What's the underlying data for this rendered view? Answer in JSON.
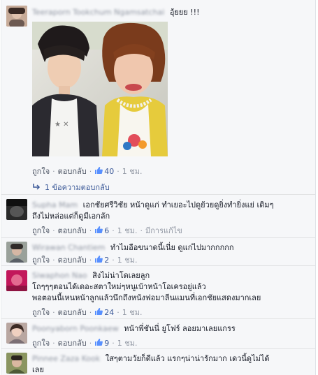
{
  "comments": [
    {
      "name": "Teeraporn Tookchum Ngamsatchai",
      "text": "อุ้ยยย !!!",
      "like_label": "ถูกใจ",
      "reply_label": "ตอบกลับ",
      "likes": "40",
      "time": "1 ชม.",
      "replies_link": "1 ข้อความตอบกลับ"
    },
    {
      "name": "Supha Mam",
      "text_lines": [
        "เอกชัยศรีวิชัย หน้าดูแก่ ทำเยอะไปดูย้วยดูยิ่งทำยิ่งแย่ เดิมๆ",
        "ถึงไม่หล่อแต่ก็ดูมีเอกลัก"
      ],
      "like_label": "ถูกใจ",
      "reply_label": "ตอบกลับ",
      "likes": "6",
      "time": "1 ชม.",
      "edited": "มีการแก้ไข"
    },
    {
      "name": "Wirawan Chantiem",
      "text": "ทำไมอือขนาดนี้เนี่ย ดูแก่ไปมากกกกก",
      "like_label": "ถูกใจ",
      "reply_label": "ตอบกลับ",
      "likes": "2",
      "time": "1 ชม."
    },
    {
      "name": "Siwaphon Nao",
      "text_lines": [
        "สิงไม่น่าโดเลยลูก",
        "โถๆๆๆตอนได้เดอะสตาใหม่ๆหนูเบ้าหน้าโอเครอยู่แล้ว",
        "พอตอนนี้เหนหน้าลูกแล้วนึกถึงหนังฟอมาลีนแมนที่เอกชัยแสดงมากเลย"
      ],
      "like_label": "ถูกใจ",
      "reply_label": "ตอบกลับ",
      "likes": "24",
      "time": "1 ชม."
    },
    {
      "name": "Poonyaborn Poonkaew",
      "text": "หน้าพี่ชันนี่ ยูโฟร์ ลอยมาเลยแกรร",
      "like_label": "ถูกใจ",
      "reply_label": "ตอบกลับ",
      "likes": "9",
      "time": "1 ชม."
    },
    {
      "name": "Pinnee Zaza Kook",
      "text_lines": [
        "ใสๆตามวัยก็ดีแล้ว แรกๆน่าน่ารักมาก เดวนี้ดูไม่ได้",
        "เลย"
      ]
    }
  ],
  "colors": {
    "link": "#3b5998",
    "meta": "#9197a3",
    "text": "#141823",
    "bg": "#f6f7f9"
  },
  "icons": {
    "like": "thumbs-up-icon",
    "reply_arrow": "reply-arrow-icon"
  }
}
